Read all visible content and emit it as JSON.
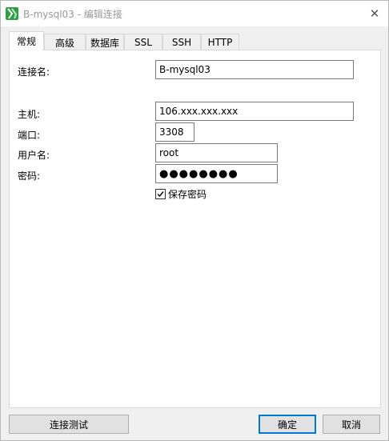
{
  "window": {
    "title": "B-mysql03 - 编辑连接",
    "close_glyph": "✕",
    "app_icon": "navicat-logo-icon",
    "accent_color": "#2ea043"
  },
  "tabs": [
    {
      "label": "常规",
      "active": true
    },
    {
      "label": "高级",
      "active": false
    },
    {
      "label": "数据库",
      "active": false
    },
    {
      "label": "SSL",
      "active": false
    },
    {
      "label": "SSH",
      "active": false
    },
    {
      "label": "HTTP",
      "active": false
    }
  ],
  "form": {
    "connection_name": {
      "label": "连接名:",
      "value": "B-mysql03"
    },
    "host": {
      "label": "主机:",
      "value": "106.xxx.xxx.xxx"
    },
    "port": {
      "label": "端口:",
      "value": "3308"
    },
    "username": {
      "label": "用户名:",
      "value": "root"
    },
    "password": {
      "label": "密码:",
      "value": "●●●●●●●●"
    },
    "save_password": {
      "label": "保存密码",
      "checked": true
    }
  },
  "buttons": {
    "test": "连接测试",
    "ok": "确定",
    "cancel": "取消"
  }
}
